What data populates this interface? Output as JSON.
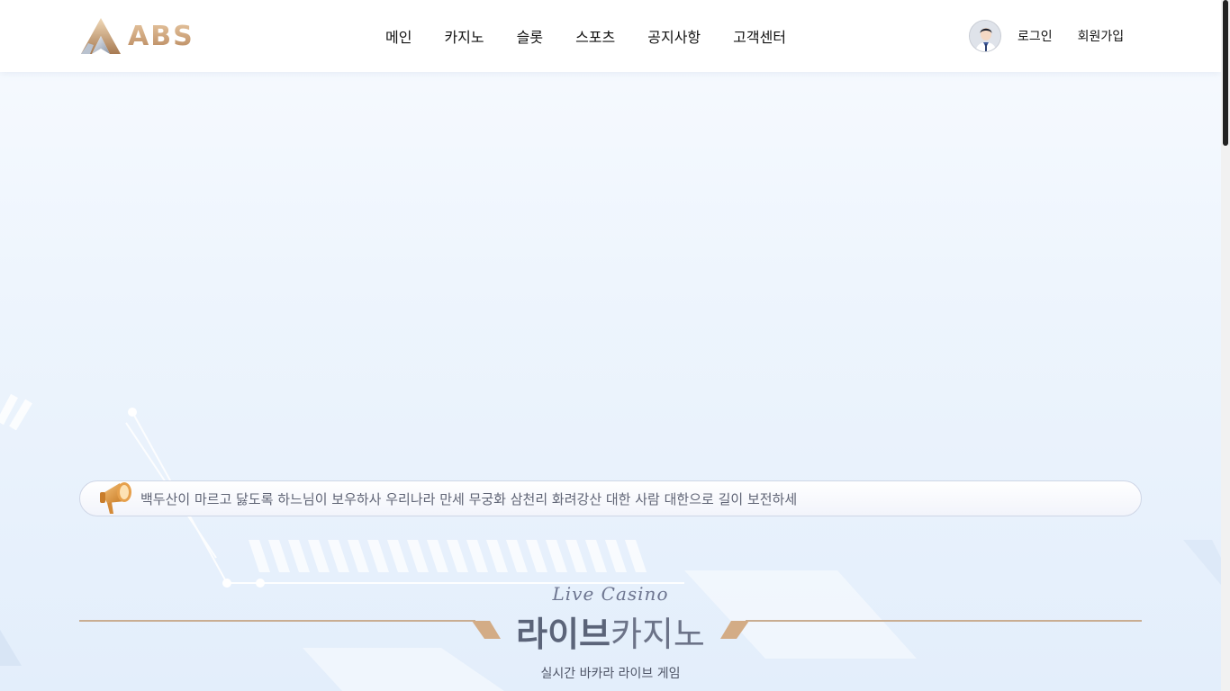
{
  "brand": {
    "name": "ABS"
  },
  "nav": {
    "items": [
      {
        "label": "메인"
      },
      {
        "label": "카지노"
      },
      {
        "label": "슬롯"
      },
      {
        "label": "스포츠"
      },
      {
        "label": "공지사항"
      },
      {
        "label": "고객센터"
      }
    ]
  },
  "user": {
    "login_label": "로그인",
    "signup_label": "회원가입"
  },
  "notice": {
    "text": "백두산이 마르고 닳도록 하느님이 보우하사 우리나라 만세 무궁화 삼천리 화려강산 대한 사람 대한으로 길이 보전하세"
  },
  "section": {
    "subtitle_en": "Live Casino",
    "title_bold": "라이브",
    "title_light": "카지노",
    "description": "실시간 바카라 라이브 게임"
  },
  "icons": {
    "logo": "abs-logo-icon",
    "avatar": "user-avatar-icon",
    "notice": "megaphone-icon"
  },
  "colors": {
    "brand_gold": "#c9a27a",
    "accent_line": "#c9ad92",
    "text_dark": "#111111",
    "notice_text": "#5f6475",
    "title_text": "#5b6479"
  }
}
